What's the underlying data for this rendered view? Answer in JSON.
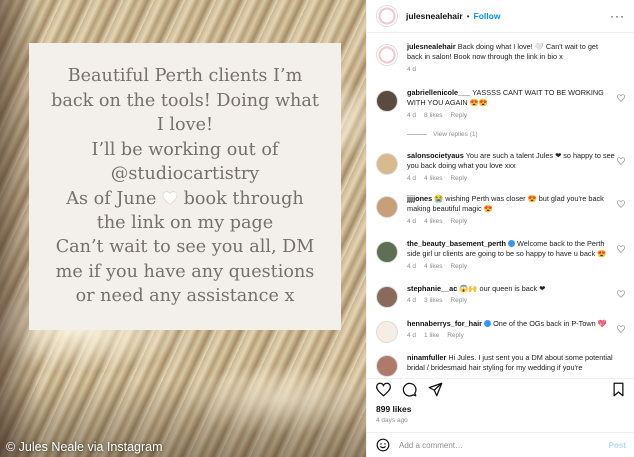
{
  "story": {
    "text_line1": "Beautiful Perth clients I’m\nback on the tools! Doing what\nI love!\nI’ll be working out of\n@studiocartistry\nAs of June",
    "text_line2": " book through\nthe link on my page\nCan’t wait to see you all, DM\nme if you have any questions\nor need any assistance x",
    "credit": "© Jules Neale via Instagram"
  },
  "header": {
    "username": "julesnealehair",
    "follow_label": "Follow",
    "more_label": "···"
  },
  "comments": [
    {
      "user": "julesnealehair",
      "text": "Back doing what I love! 🤍 Can't wait to get back in salon! Book now through the link in bio x",
      "time": "4 d",
      "likes": "",
      "reply": ""
    },
    {
      "user": "gabriellenicole___",
      "text": "YASSSS CANT WAIT TO BE WORKING WITH YOU AGAIN 😍😍",
      "time": "4 d",
      "likes": "8 likes",
      "reply": "Reply"
    },
    {
      "user": "salonsocietyaus",
      "text": "You are such a talent Jules ❤ so happy to see you back doing what you love xxx",
      "time": "4 d",
      "likes": "4 likes",
      "reply": "Reply"
    },
    {
      "user": "jjjjones",
      "text": "😭 wishing Perth was closer 😍 but glad you're back making beautiful magic 😍",
      "time": "4 d",
      "likes": "4 likes",
      "reply": "Reply"
    },
    {
      "user": "the_beauty_basement_perth",
      "text": "Welcome back to the Perth side girl ur clients are going to be so happy to have u back 😍",
      "time": "4 d",
      "likes": "4 likes",
      "reply": "Reply"
    },
    {
      "user": "stephanie__ac",
      "text": "😱🙌 our queen is back ❤",
      "time": "4 d",
      "likes": "3 likes",
      "reply": "Reply"
    },
    {
      "user": "hennaberrys_for_hair",
      "text": "One of the OGs back in P-Town 💖",
      "time": "4 d",
      "likes": "1 like",
      "reply": "Reply"
    },
    {
      "user": "ninamfuller",
      "text": "Hi Jules. I just sent you a DM about some potential bridal / bridesmaid hair styling for my wedding if you're",
      "time": "",
      "likes": "",
      "reply": ""
    }
  ],
  "view_replies": "View replies (1)",
  "likes_count": "899 likes",
  "posted_ago": "4 days ago",
  "add_comment": {
    "placeholder": "Add a comment…",
    "post_label": "Post"
  },
  "colors": {
    "accent": "#0095f6",
    "heart": "#ed4956",
    "story_text": "#77706a",
    "story_bg": "#f3efea"
  }
}
